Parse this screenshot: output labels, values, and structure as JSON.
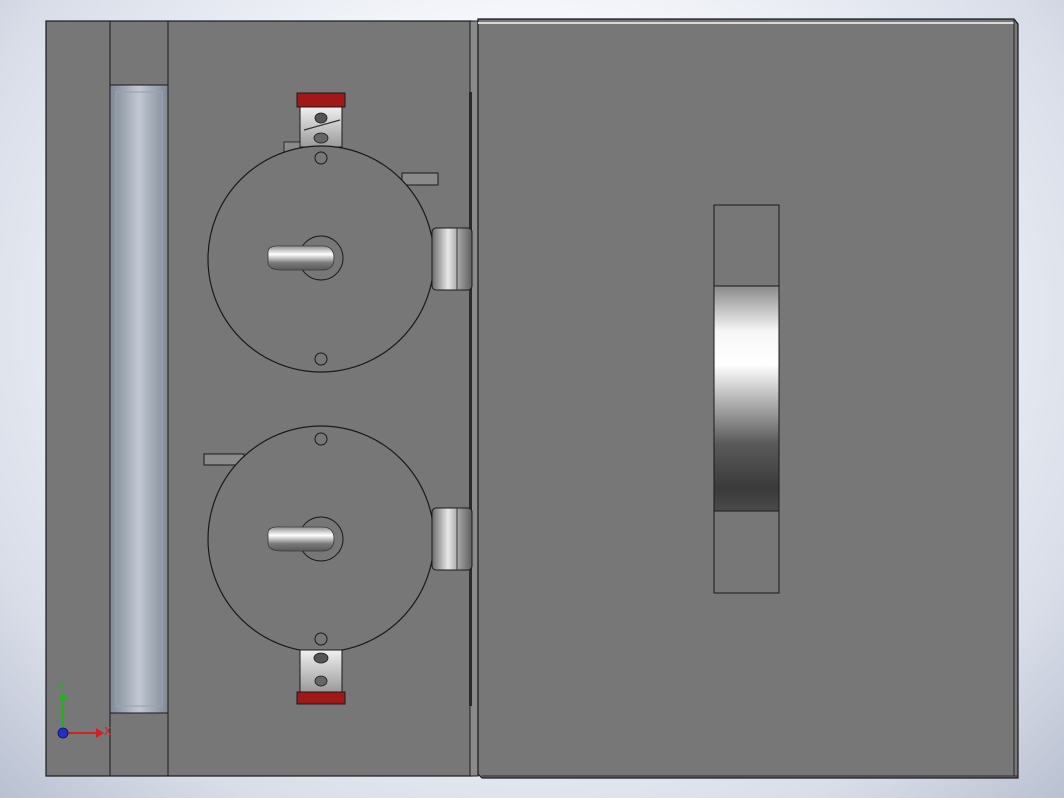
{
  "viewport": {
    "background_top": "#ffffff",
    "background_bottom": "#b9c0d0"
  },
  "model": {
    "part_color": "#777777",
    "edge_color": "#1a1a1a",
    "accent_red": "#a01818"
  },
  "triad": {
    "x_label": "X",
    "y_label": "Y",
    "x_color": "#d42020",
    "y_color": "#20b020",
    "z_color": "#2030c8"
  }
}
